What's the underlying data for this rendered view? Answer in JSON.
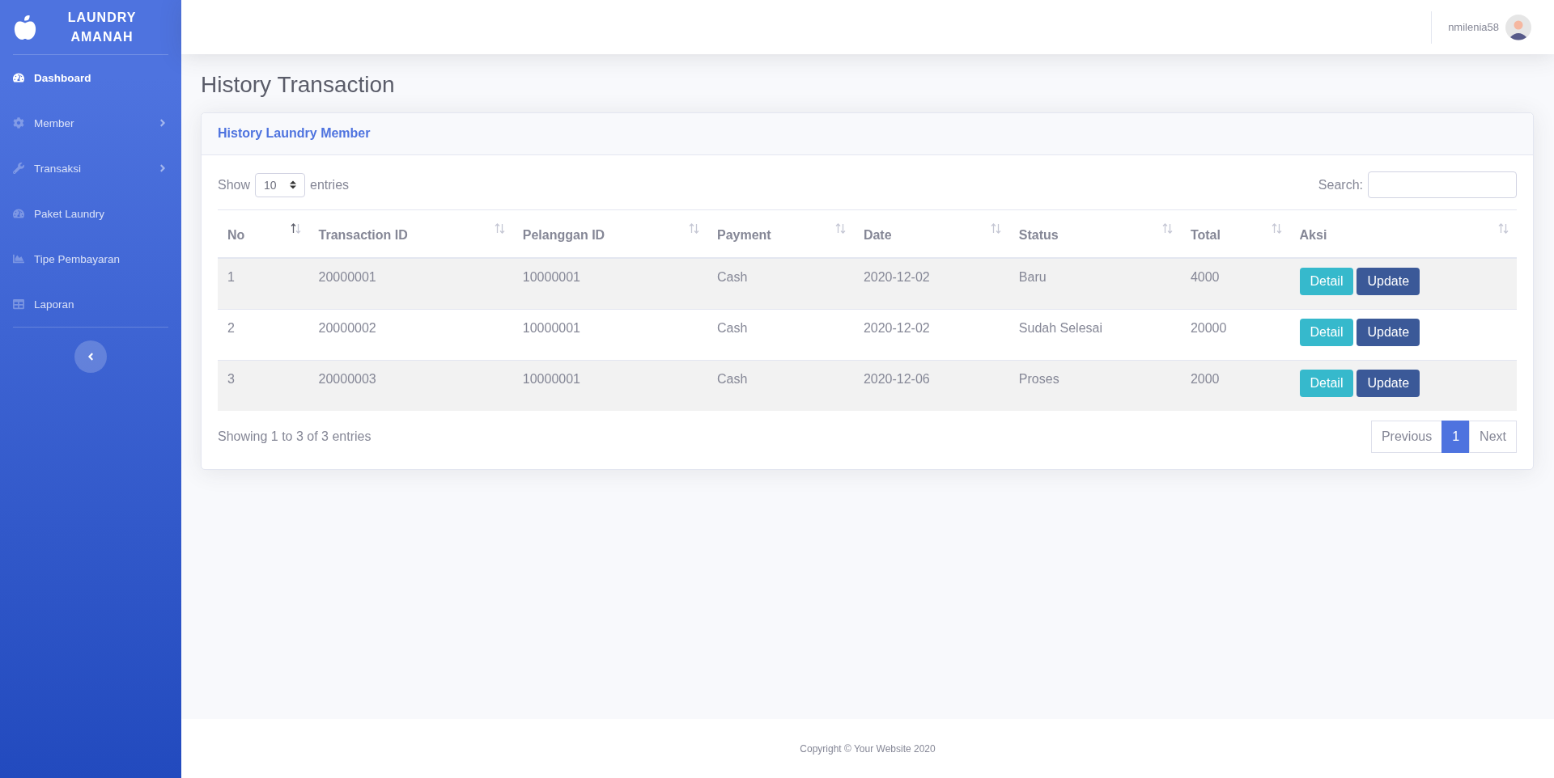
{
  "sidebar": {
    "brand": "LAUNDRY AMANAH",
    "items": [
      {
        "label": "Dashboard",
        "selected": true,
        "kind": "link"
      },
      {
        "label": "Member",
        "selected": false,
        "kind": "submenu"
      },
      {
        "label": "Transaksi",
        "selected": false,
        "kind": "submenu"
      },
      {
        "label": "Paket Laundry",
        "selected": false,
        "kind": "link"
      },
      {
        "label": "Tipe Pembayaran",
        "selected": false,
        "kind": "link"
      },
      {
        "label": "Laporan",
        "selected": false,
        "kind": "link"
      }
    ]
  },
  "topbar": {
    "user": "nmilenia58"
  },
  "page_title": "History Transaction",
  "card": {
    "title": "History Laundry Member",
    "length": {
      "before": "Show",
      "value": "10",
      "after": "entries"
    },
    "search": {
      "label": "Search:"
    },
    "table": {
      "columns": [
        {
          "label": "No",
          "sorted": true
        },
        {
          "label": "Transaction ID",
          "sorted": false
        },
        {
          "label": "Pelanggan ID",
          "sorted": false
        },
        {
          "label": "Payment",
          "sorted": false
        },
        {
          "label": "Date",
          "sorted": false
        },
        {
          "label": "Status",
          "sorted": false
        },
        {
          "label": "Total",
          "sorted": false
        },
        {
          "label": "Aksi",
          "sorted": false
        }
      ],
      "rows": [
        {
          "cells": [
            "1",
            "20000001",
            "10000001",
            "Cash",
            "2020-12-02",
            "Baru",
            "4000"
          ],
          "actions": [
            {
              "label": "Detail",
              "kind": "info"
            },
            {
              "label": "Update",
              "kind": "primary"
            }
          ]
        },
        {
          "cells": [
            "2",
            "20000002",
            "10000001",
            "Cash",
            "2020-12-02",
            "Sudah Selesai",
            "20000"
          ],
          "actions": [
            {
              "label": "Detail",
              "kind": "info"
            },
            {
              "label": "Update",
              "kind": "primary"
            }
          ]
        },
        {
          "cells": [
            "3",
            "20000003",
            "10000001",
            "Cash",
            "2020-12-06",
            "Proses",
            "2000"
          ],
          "actions": [
            {
              "label": "Detail",
              "kind": "info"
            },
            {
              "label": "Update",
              "kind": "primary"
            }
          ]
        }
      ]
    },
    "info": "Showing 1 to 3 of 3 entries",
    "pagination": [
      {
        "label": "Previous",
        "selected": false
      },
      {
        "label": "1",
        "selected": true
      },
      {
        "label": "Next",
        "selected": false
      }
    ]
  },
  "footer": "Copyright © Your Website 2020"
}
